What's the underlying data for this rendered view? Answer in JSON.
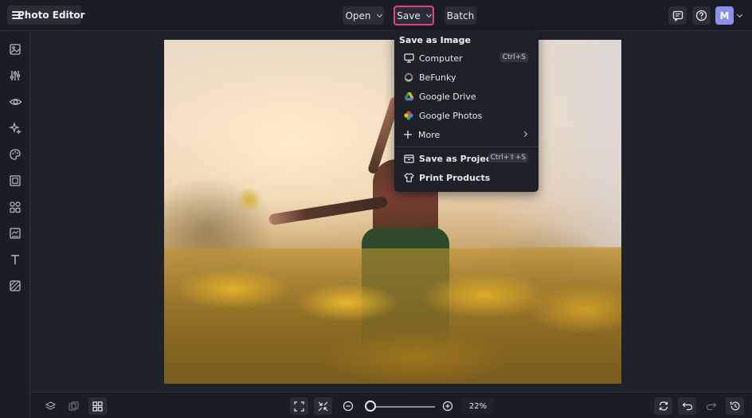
{
  "app": {
    "title": "Photo Editor",
    "avatar_initial": "M"
  },
  "topbar": {
    "open_label": "Open",
    "save_label": "Save",
    "batch_label": "Batch"
  },
  "save_menu": {
    "header": "Save as Image",
    "items": [
      {
        "label": "Computer",
        "icon": "monitor-icon",
        "shortcut": "Ctrl+S"
      },
      {
        "label": "BeFunky",
        "icon": "befunky-logo-icon"
      },
      {
        "label": "Google Drive",
        "icon": "google-drive-icon"
      },
      {
        "label": "Google Photos",
        "icon": "google-photos-icon"
      },
      {
        "label": "More",
        "icon": "plus-icon"
      },
      {
        "label": "Save as Project",
        "icon": "project-box-icon",
        "shortcut": "Ctrl+⇧+S"
      },
      {
        "label": "Print Products",
        "icon": "shirt-icon"
      }
    ]
  },
  "sidebar": {
    "icons": [
      "image-icon",
      "sliders-icon",
      "eye-icon",
      "sparkle-effects-icon",
      "palette-icon",
      "frame-icon",
      "shapes-icon",
      "crop-icon",
      "text-icon",
      "texture-icon"
    ]
  },
  "bottombar": {
    "zoom_value": "22%",
    "zoom_level": 0.06
  },
  "colors": {
    "accent_highlight": "#e83e8c",
    "avatar": "#8d8ff0",
    "background": "#20222b",
    "panel": "#1b1d24"
  }
}
